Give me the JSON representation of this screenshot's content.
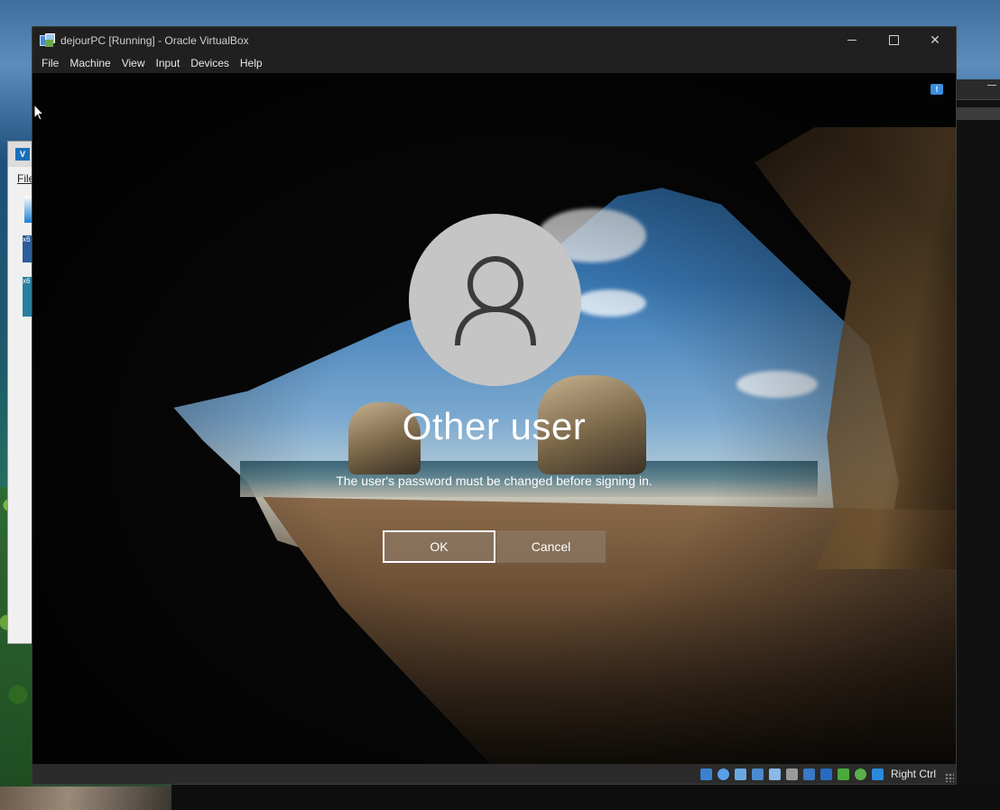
{
  "window": {
    "title": "dejourPC [Running] - Oracle VirtualBox",
    "controls": {
      "minimize": "minimize",
      "maximize": "maximize",
      "close": "✕"
    }
  },
  "menu": {
    "items": [
      "File",
      "Machine",
      "View",
      "Input",
      "Devices",
      "Help"
    ]
  },
  "background_window": {
    "file_menu": "File",
    "vm_labels": [
      "x6",
      "x6"
    ]
  },
  "login": {
    "username": "Other user",
    "message": "The user's password must be changed before signing in.",
    "ok_label": "OK",
    "cancel_label": "Cancel"
  },
  "status_bar": {
    "host_key": "Right Ctrl",
    "icons": [
      "hard-disk-icon",
      "optical-drive-icon",
      "audio-icon",
      "network-icon",
      "usb-icon",
      "shared-folders-icon",
      "display-icon",
      "recording-icon",
      "mouse-integration-icon",
      "cpu-icon",
      "keyboard-icon"
    ]
  },
  "colors": {
    "titlebar": "#202020",
    "avatar": "#c5c5c5",
    "button_fill": "#8c7864",
    "accent_blue": "#3b8ee0"
  }
}
